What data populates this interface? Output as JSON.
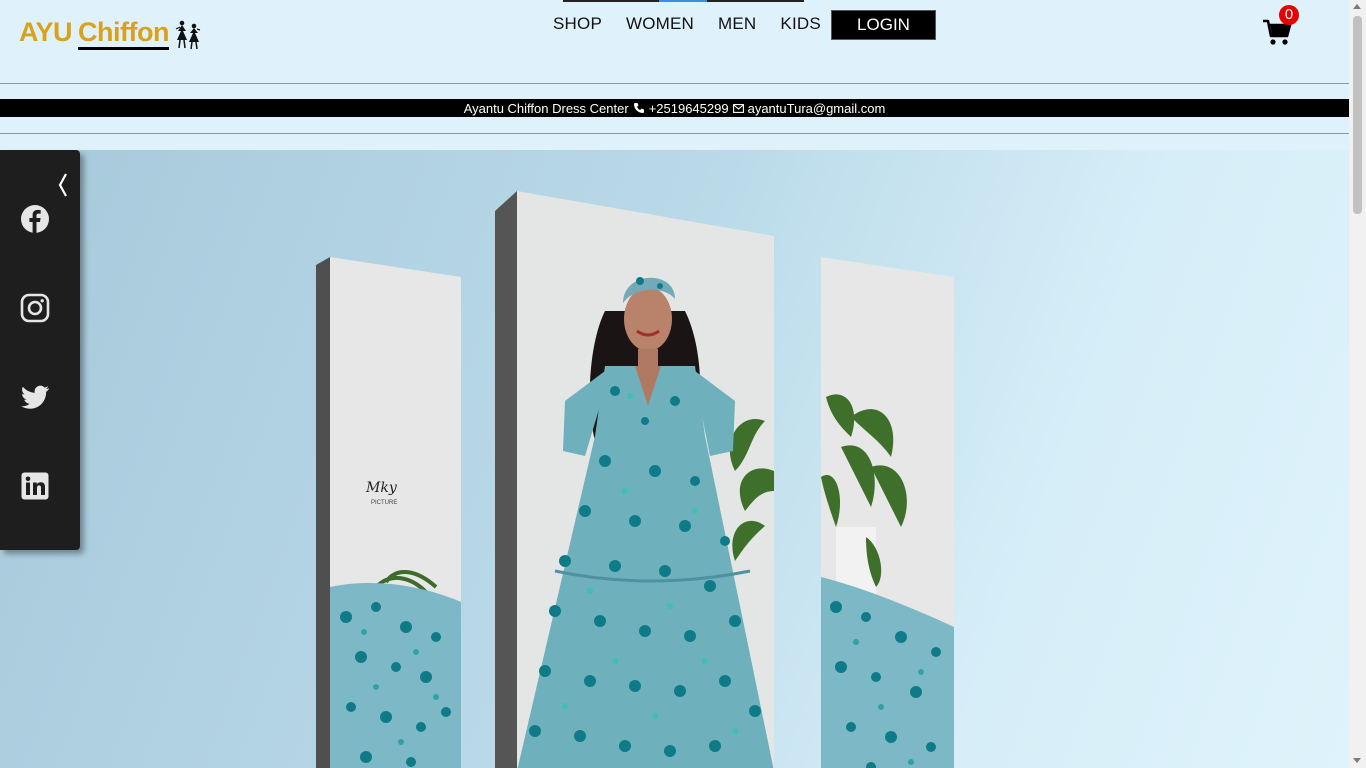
{
  "brand": {
    "name_part1": "AYU",
    "name_part2": "Chiffon",
    "color": "#d9a21c"
  },
  "nav": {
    "items": [
      "SHOP",
      "WOMEN",
      "MEN",
      "KIDS"
    ],
    "login_label": "LOGIN"
  },
  "cart": {
    "count": "0",
    "icon": "cart-icon"
  },
  "infobar": {
    "store_name": "Ayantu Chiffon Dress Center",
    "phone": "+2519645299",
    "email": "ayantuTura@gmail.com"
  },
  "social": {
    "icons": [
      "facebook-icon",
      "instagram-icon",
      "twitter-icon",
      "linkedin-icon"
    ],
    "toggle_icon": "chevron-left-icon"
  },
  "hero": {
    "dress_color": "#6fb0bd",
    "accent": "#0f7b86"
  },
  "colors": {
    "header_bg": "#dff2fb",
    "infobar_bg": "#000000",
    "badge": "#e60000"
  }
}
